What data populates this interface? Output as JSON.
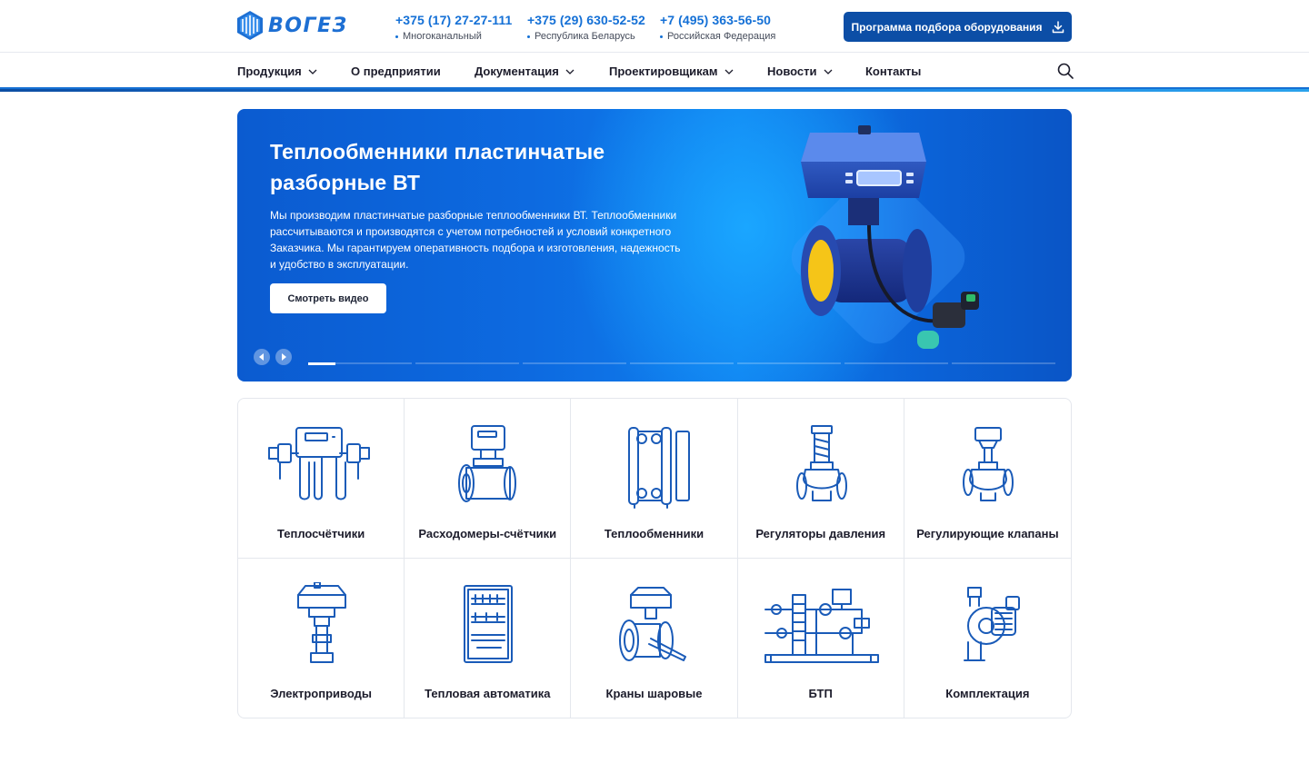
{
  "header": {
    "logo_text": "ВОГЕЗ",
    "phones": [
      {
        "number": "+375 (17) 27-27-111",
        "caption": "Многоканальный"
      },
      {
        "number": "+375 (29) 630-52-52",
        "caption": "Республика Беларусь"
      },
      {
        "number": "+7 (495) 363-56-50",
        "caption": "Российская Федерация"
      }
    ],
    "cta_label": "Программа подбора оборудования",
    "cta_icon": "download-icon"
  },
  "nav": {
    "items": [
      {
        "label": "Продукция",
        "has_dropdown": true
      },
      {
        "label": "О предприятии",
        "has_dropdown": false
      },
      {
        "label": "Документация",
        "has_dropdown": true
      },
      {
        "label": "Проектировщикам",
        "has_dropdown": true
      },
      {
        "label": "Новости",
        "has_dropdown": true
      },
      {
        "label": "Контакты",
        "has_dropdown": false
      }
    ],
    "search_icon": "search-icon"
  },
  "hero": {
    "title": "Теплообменники пластинчатые разборные ВТ",
    "text": "Мы производим пластинчатые разборные теплообменники ВТ. Теплообменники рассчитываются и производятся с учетом потребностей и условий конкретного Заказчика. Мы гарантируем оперативность подбора и изготовления, надежность и удобство в эксплуатации.",
    "button_label": "Смотреть видео",
    "slides_count": 7,
    "active_slide": 1,
    "active_progress": 0.26
  },
  "categories": [
    {
      "label": "Теплосчётчики",
      "icon": "heat-meter-icon"
    },
    {
      "label": "Расходомеры-счётчики",
      "icon": "flowmeter-icon"
    },
    {
      "label": "Теплообменники",
      "icon": "heat-exchanger-icon"
    },
    {
      "label": "Регуляторы давления",
      "icon": "pressure-regulator-icon"
    },
    {
      "label": "Регулирующие клапаны",
      "icon": "control-valve-icon"
    },
    {
      "label": "Электроприводы",
      "icon": "electric-actuator-icon"
    },
    {
      "label": "Тепловая автоматика",
      "icon": "control-cabinet-icon"
    },
    {
      "label": "Краны шаровые",
      "icon": "ball-valve-icon"
    },
    {
      "label": "БТП",
      "icon": "heat-substation-icon"
    },
    {
      "label": "Комплектация",
      "icon": "pump-icon"
    }
  ],
  "colors": {
    "brand": "#1470d6",
    "cta": "#0c4ea6",
    "hero_dark": "#0a55c6",
    "icon_stroke": "#1a5bb8"
  }
}
